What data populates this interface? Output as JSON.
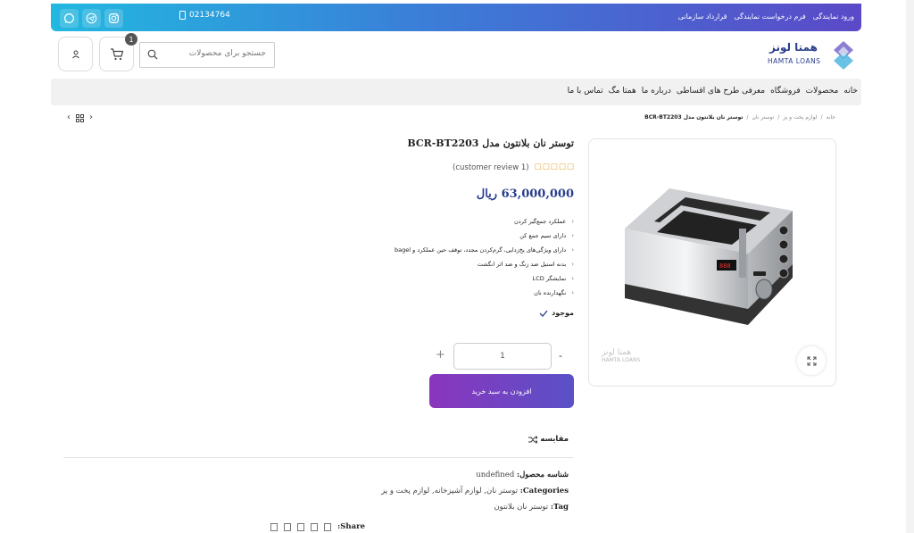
{
  "topbar": {
    "phone": "02134764",
    "links": [
      "ورود نمایندگی",
      "فرم درخواست نمایندگی",
      "قرارداد سازمانی"
    ],
    "colors": {
      "start": "#22b8e0",
      "end": "#5b49c8"
    }
  },
  "header": {
    "search_placeholder": "جستجو برای محصولات",
    "cart_count": "1",
    "logo_text": "همتا لونز",
    "logo_subtext": "HAMTA LOANS"
  },
  "nav": {
    "items": [
      "خانه",
      "محصولات",
      "فروشگاه",
      "معرفی طرح های اقساطی",
      "درباره ما",
      "همتا مگ",
      "تماس با ما"
    ]
  },
  "breadcrumb": {
    "items": [
      "خانه",
      "لوازم پخت و پز",
      "توستر نان"
    ],
    "current": "توستر نان بلانتون مدل BCR-BT2203"
  },
  "product": {
    "title": "توستر نان بلانتون مدل BCR-BT2203",
    "review_text": "(customer review 1)",
    "rating": 0,
    "price": "63,000,000 ریال",
    "features": [
      "عملکرد جمع‌گیر کردن",
      "دارای سیم جمع کن",
      "دارای ویژگی‌های یخ‌زدایی، گرم‌کردن مجدد، توقف حین عملکرد و bagel",
      "بدنه استیل ضد زنگ و ضد اثر انگشت",
      "نمایشگر LCD",
      "نگهدارنده نان"
    ],
    "stock": "موجود",
    "quantity": "1",
    "add_to_cart": "افزودن به سبد خرید",
    "compare": "مقایسه",
    "watermark": "HAMTA LOANS",
    "sku_label": "شناسه محصول:",
    "sku_value": "undefined",
    "categories_label": "Categories:",
    "categories_value": "توستر نان, لوازم آشپزخانه, لوازم پخت و پز",
    "tag_label": "Tag:",
    "tag_value": "توستر نان بلانتون",
    "share_label": "Share:"
  },
  "accent": "#2a3e8c"
}
